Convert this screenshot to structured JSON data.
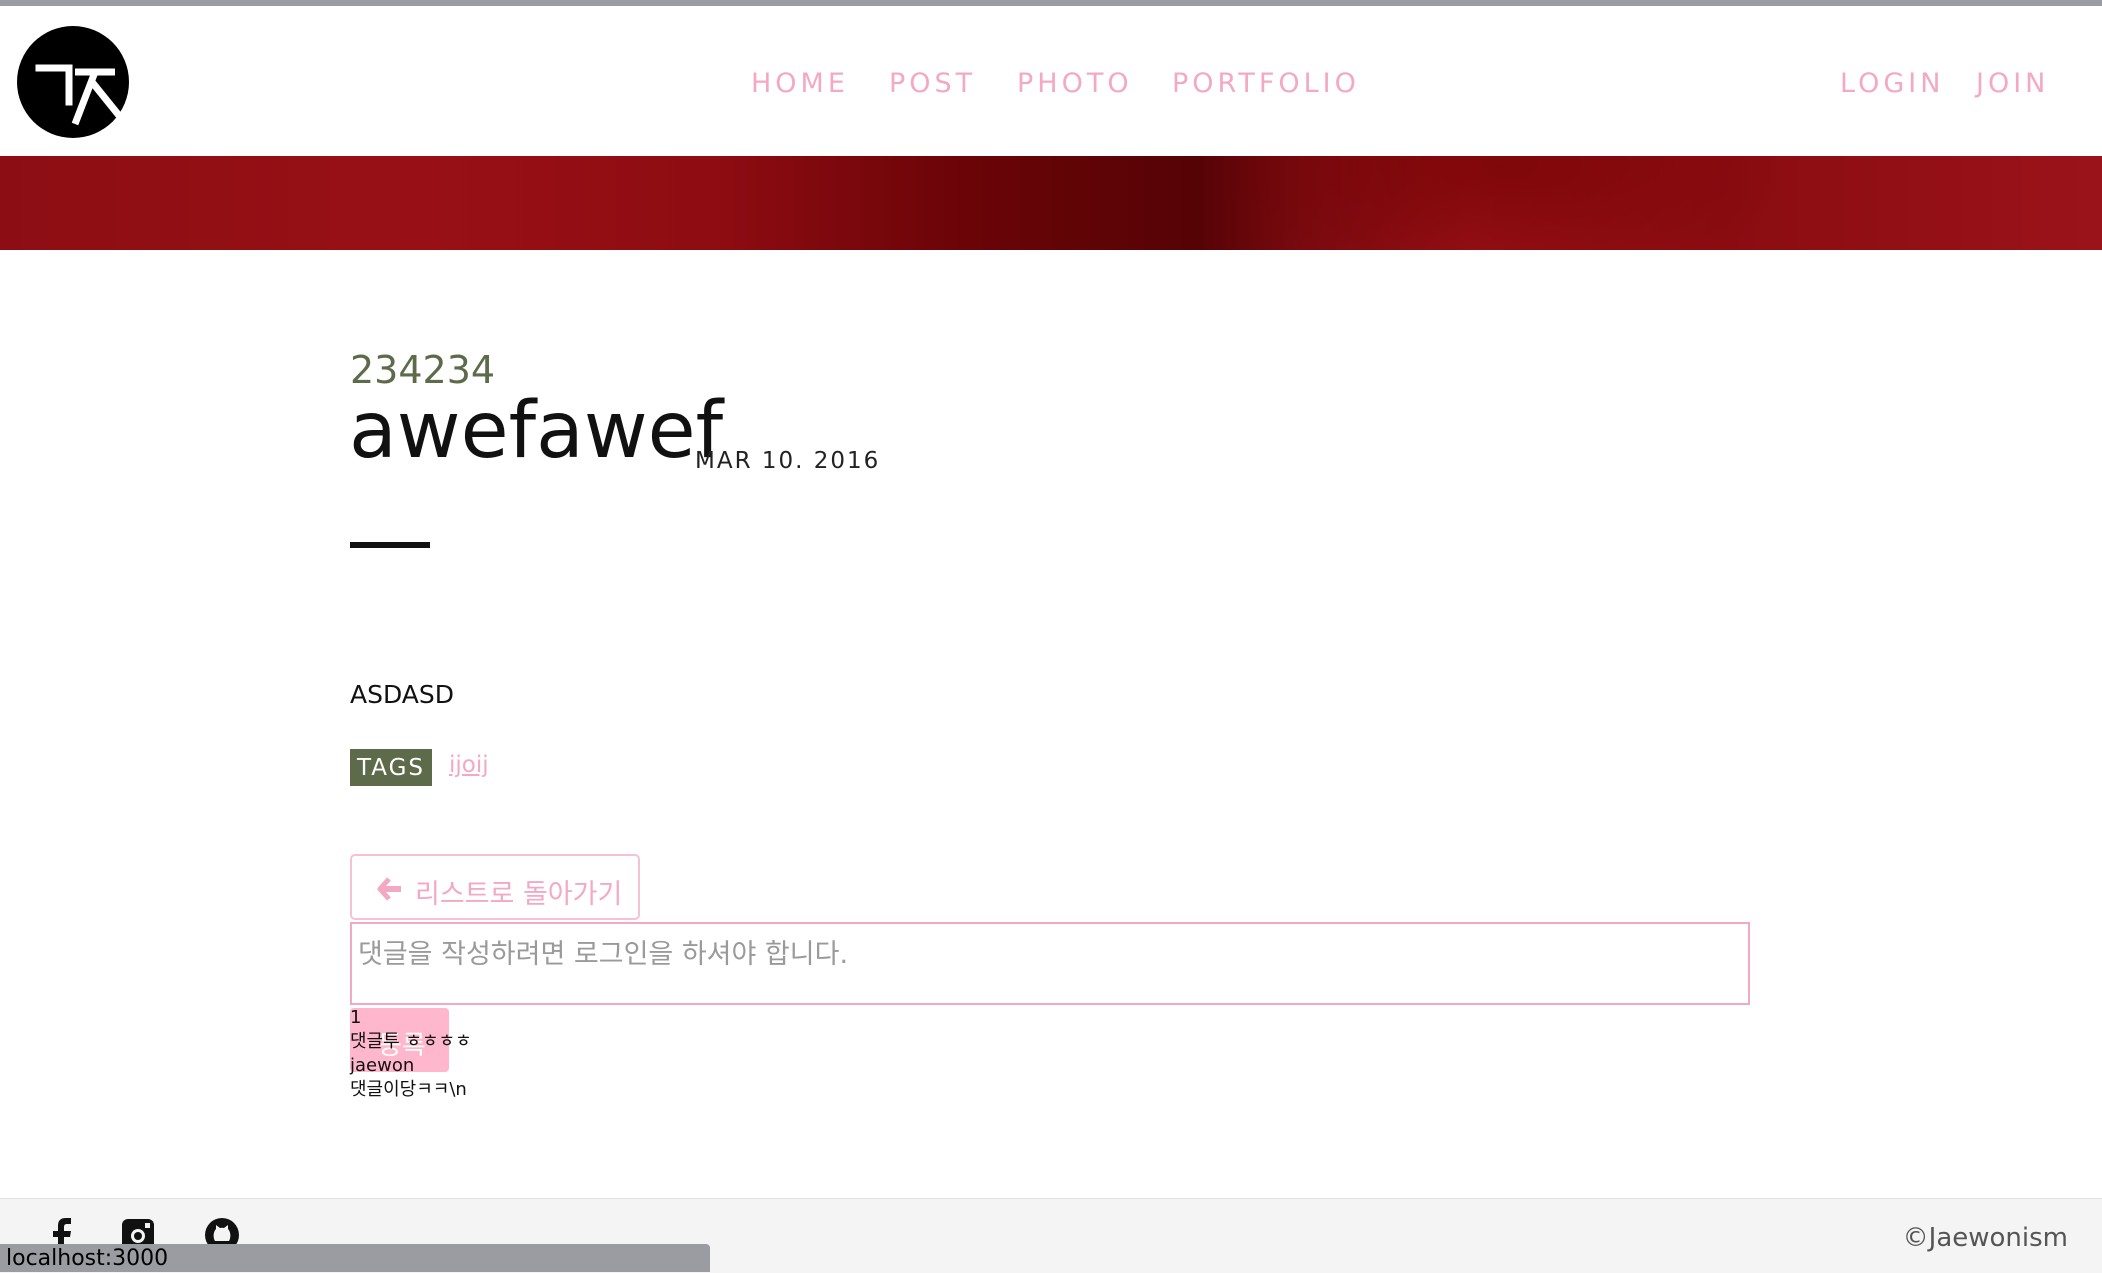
{
  "nav": {
    "home": "HOME",
    "post": "POST",
    "photo": "PHOTO",
    "portfolio": "PORTFOLIO"
  },
  "auth": {
    "login": "LOGIN",
    "join": "JOIN"
  },
  "post": {
    "category": "234234",
    "title": "awefawef",
    "date": "MAR 10. 2016",
    "body": "ASDASD",
    "tags_label": "TAGS",
    "tags": [
      "ijoij"
    ]
  },
  "actions": {
    "back_label": "리스트로 돌아가기",
    "comment_placeholder": "댓글을 작성하려면 로그인을 하셔야 합니다.",
    "submit_label": "등록"
  },
  "comments": [
    {
      "author": "1",
      "text": "댓글투 ㅎㅎㅎㅎ"
    },
    {
      "author": "jaewon",
      "text": "댓글이당ㅋㅋ\\n"
    }
  ],
  "footer": {
    "copyright": "©Jaewonism",
    "social_icons": [
      "facebook-icon",
      "instagram-icon",
      "github-icon"
    ]
  },
  "statusbar": {
    "url": "localhost:3000"
  },
  "colors": {
    "accent_pink": "#f4a9c2",
    "category_green": "#5d6b4a",
    "banner_red": "#8c0e14"
  }
}
